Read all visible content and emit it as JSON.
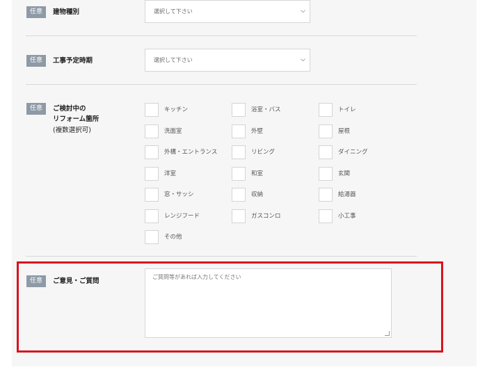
{
  "fields": [
    {
      "badge": "任意",
      "label": "建物種別",
      "placeholder": "選択して下さい"
    },
    {
      "badge": "任意",
      "label": "工事予定時期",
      "placeholder": "選択して下さい"
    }
  ],
  "reform": {
    "badge": "任意",
    "label_lines": [
      "ご検討中の",
      "リフォーム箇所",
      "(複数選択可)"
    ],
    "options": [
      "キッチン",
      "浴室・バス",
      "トイレ",
      "洗面室",
      "外壁",
      "屋根",
      "外構・エントランス",
      "リビング",
      "ダイニング",
      "洋室",
      "和室",
      "玄関",
      "窓・サッシ",
      "収納",
      "給湯器",
      "レンジフード",
      "ガスコンロ",
      "小工事",
      "その他"
    ]
  },
  "opinion": {
    "badge": "任意",
    "label": "ご意見・ご質問",
    "placeholder": "ご質問等があれば入力してください"
  },
  "colors": {
    "highlight": "#d8121c",
    "badge_bg": "#8e9aa6"
  }
}
